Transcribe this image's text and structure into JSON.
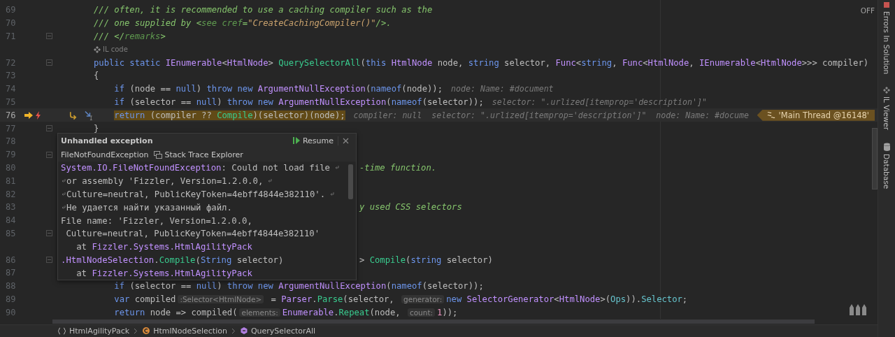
{
  "editor": {
    "inspection_toggle": "OFF",
    "rows": [
      {
        "kind": "line",
        "number": "69",
        "current": false,
        "tokens": [
          {
            "text": "/// often, it is recommended to use a caching compiler such as the",
            "kind": "comment"
          }
        ]
      },
      {
        "kind": "line",
        "number": "70",
        "current": false,
        "tokens": [
          {
            "text": "/// one supplied by <",
            "kind": "comment"
          },
          {
            "text": "see cref",
            "kind": "doc_tag"
          },
          {
            "text": "=",
            "kind": "comment"
          },
          {
            "text": "\"CreateCachingCompiler()\"",
            "kind": "doc_string"
          },
          {
            "text": "/>.",
            "kind": "comment"
          }
        ]
      },
      {
        "kind": "line",
        "number": "71",
        "current": false,
        "fold": true,
        "tokens": [
          {
            "text": "/// </",
            "kind": "comment"
          },
          {
            "text": "remarks",
            "kind": "doc_tag"
          },
          {
            "text": ">",
            "kind": "comment"
          }
        ]
      },
      {
        "kind": "lens",
        "label": "IL code"
      },
      {
        "kind": "line",
        "number": "72",
        "current": false,
        "fold": true,
        "tokens": [
          {
            "text": "public static ",
            "kind": "keyword"
          },
          {
            "text": "IEnumerable",
            "kind": "type"
          },
          {
            "text": "<",
            "kind": "plain"
          },
          {
            "text": "HtmlNode",
            "kind": "type"
          },
          {
            "text": "> ",
            "kind": "plain"
          },
          {
            "text": "QuerySelectorAll",
            "kind": "method"
          },
          {
            "text": "(",
            "kind": "plain"
          },
          {
            "text": "this ",
            "kind": "keyword"
          },
          {
            "text": "HtmlNode",
            "kind": "type"
          },
          {
            "text": " node, ",
            "kind": "plain"
          },
          {
            "text": "string",
            "kind": "keyword"
          },
          {
            "text": " selector, ",
            "kind": "plain"
          },
          {
            "text": "Func",
            "kind": "type"
          },
          {
            "text": "<",
            "kind": "plain"
          },
          {
            "text": "string",
            "kind": "keyword"
          },
          {
            "text": ", ",
            "kind": "plain"
          },
          {
            "text": "Func",
            "kind": "type"
          },
          {
            "text": "<",
            "kind": "plain"
          },
          {
            "text": "HtmlNode",
            "kind": "type"
          },
          {
            "text": ", ",
            "kind": "plain"
          },
          {
            "text": "IEnumerable",
            "kind": "type"
          },
          {
            "text": "<",
            "kind": "plain"
          },
          {
            "text": "HtmlNode",
            "kind": "type"
          },
          {
            "text": ">>> compiler)",
            "kind": "plain"
          }
        ]
      },
      {
        "kind": "line",
        "number": "73",
        "current": false,
        "tokens": [
          {
            "text": "{",
            "kind": "plain"
          }
        ]
      },
      {
        "kind": "line",
        "number": "74",
        "current": false,
        "tokens": [
          {
            "text": "    if",
            "kind": "keyword"
          },
          {
            "text": " (node == ",
            "kind": "plain"
          },
          {
            "text": "null",
            "kind": "keyword"
          },
          {
            "text": ") ",
            "kind": "plain"
          },
          {
            "text": "throw new ",
            "kind": "keyword"
          },
          {
            "text": "ArgumentNullException",
            "kind": "type"
          },
          {
            "text": "(",
            "kind": "plain"
          },
          {
            "text": "nameof",
            "kind": "keyword"
          },
          {
            "text": "(node));",
            "kind": "plain"
          },
          {
            "text": "node: Name: #document",
            "kind": "value"
          }
        ]
      },
      {
        "kind": "line",
        "number": "75",
        "current": false,
        "tokens": [
          {
            "text": "    if",
            "kind": "keyword"
          },
          {
            "text": " (selector == ",
            "kind": "plain"
          },
          {
            "text": "null",
            "kind": "keyword"
          },
          {
            "text": ") ",
            "kind": "plain"
          },
          {
            "text": "throw new ",
            "kind": "keyword"
          },
          {
            "text": "ArgumentNullException",
            "kind": "type"
          },
          {
            "text": "(",
            "kind": "plain"
          },
          {
            "text": "nameof",
            "kind": "keyword"
          },
          {
            "text": "(selector));",
            "kind": "plain"
          },
          {
            "text": "selector: \".urlized[itemprop='description']\"",
            "kind": "value"
          }
        ]
      },
      {
        "kind": "line",
        "number": "76",
        "current": true,
        "tokens": [
          {
            "text": "    return",
            "kind": "keyword"
          },
          {
            "text": " (compiler ?? ",
            "kind": "plain"
          },
          {
            "text": "Compile",
            "kind": "method"
          },
          {
            "text": ")(selector)(node);",
            "kind": "plain"
          },
          {
            "text": "compiler: null  selector: \".urlized[itemprop='description']\"  node: Name: #docume",
            "kind": "value"
          }
        ],
        "thread_badge": "'Main Thread @16148'"
      },
      {
        "kind": "line",
        "number": "77",
        "current": false,
        "fold": true,
        "tokens": [
          {
            "text": "}",
            "kind": "plain"
          }
        ]
      },
      {
        "kind": "line",
        "number": "78",
        "current": false,
        "tokens": []
      },
      {
        "kind": "line",
        "number": "79",
        "current": false,
        "fold": true,
        "tokens": []
      },
      {
        "kind": "line",
        "number": "80",
        "current": false,
        "covered": true,
        "tokens": [
          {
            "text": "-time function.",
            "kind": "comment"
          }
        ]
      },
      {
        "kind": "line",
        "number": "81",
        "current": false,
        "tokens": []
      },
      {
        "kind": "line",
        "number": "82",
        "current": false,
        "tokens": []
      },
      {
        "kind": "line",
        "number": "83",
        "current": false,
        "covered": true,
        "tokens": [
          {
            "text": "y used CSS selectors",
            "kind": "comment"
          }
        ]
      },
      {
        "kind": "line",
        "number": "84",
        "current": false,
        "tokens": []
      },
      {
        "kind": "line",
        "number": "85",
        "current": false,
        "fold": true,
        "tokens": []
      },
      {
        "kind": "spacer"
      },
      {
        "kind": "line",
        "number": "86",
        "current": false,
        "fold": true,
        "covered": true,
        "tokens": [
          {
            "text": "> ",
            "kind": "plain"
          },
          {
            "text": "Compile",
            "kind": "method"
          },
          {
            "text": "(",
            "kind": "plain"
          },
          {
            "text": "string",
            "kind": "keyword"
          },
          {
            "text": " selector)",
            "kind": "plain"
          }
        ]
      },
      {
        "kind": "line",
        "number": "87",
        "current": false,
        "tokens": []
      },
      {
        "kind": "line",
        "number": "88",
        "current": false,
        "tokens": [
          {
            "text": "    if",
            "kind": "keyword"
          },
          {
            "text": " (selector == ",
            "kind": "plain"
          },
          {
            "text": "null",
            "kind": "keyword"
          },
          {
            "text": ") ",
            "kind": "plain"
          },
          {
            "text": "throw new ",
            "kind": "keyword"
          },
          {
            "text": "ArgumentNullException",
            "kind": "type"
          },
          {
            "text": "(",
            "kind": "plain"
          },
          {
            "text": "nameof",
            "kind": "keyword"
          },
          {
            "text": "(selector));",
            "kind": "plain"
          }
        ]
      },
      {
        "kind": "line",
        "number": "89",
        "current": false,
        "tokens": [
          {
            "text": "    var",
            "kind": "keyword"
          },
          {
            "text": " compiled",
            "kind": "plain"
          },
          {
            "text": ":Selector<HtmlNode>",
            "kind": "inlay"
          },
          {
            "text": " = ",
            "kind": "plain"
          },
          {
            "text": "Parser",
            "kind": "type"
          },
          {
            "text": ".",
            "kind": "plain"
          },
          {
            "text": "Parse",
            "kind": "method"
          },
          {
            "text": "(selector, ",
            "kind": "plain"
          },
          {
            "text": "generator:",
            "kind": "inlay"
          },
          {
            "text": "new ",
            "kind": "keyword"
          },
          {
            "text": "SelectorGenerator",
            "kind": "type"
          },
          {
            "text": "<",
            "kind": "plain"
          },
          {
            "text": "HtmlNode",
            "kind": "type"
          },
          {
            "text": ">(",
            "kind": "plain"
          },
          {
            "text": "Ops",
            "kind": "field"
          },
          {
            "text": ")).",
            "kind": "plain"
          },
          {
            "text": "Selector",
            "kind": "field"
          },
          {
            "text": ";",
            "kind": "plain"
          }
        ]
      },
      {
        "kind": "line",
        "number": "90",
        "current": false,
        "tokens": [
          {
            "text": "    return",
            "kind": "keyword"
          },
          {
            "text": " node => compiled(",
            "kind": "plain"
          },
          {
            "text": "elements:",
            "kind": "inlay"
          },
          {
            "text": "Enumerable",
            "kind": "type"
          },
          {
            "text": ".",
            "kind": "plain"
          },
          {
            "text": "Repeat",
            "kind": "method"
          },
          {
            "text": "(node, ",
            "kind": "plain"
          },
          {
            "text": "count:",
            "kind": "inlay"
          },
          {
            "text": "1",
            "kind": "number"
          },
          {
            "text": "));",
            "kind": "plain"
          }
        ]
      }
    ]
  },
  "exception_popup": {
    "title": "Unhandled exception",
    "resume": "Resume",
    "exception_type": "FileNotFoundException",
    "stack_trace_link": "Stack Trace Explorer",
    "message_lines": [
      {
        "wrap_start": false,
        "wrap_end": true,
        "tokens": [
          {
            "text": "System.IO.FileNotFoundException",
            "kind": "type"
          },
          {
            "text": ": Could not load file",
            "kind": "plain"
          }
        ]
      },
      {
        "wrap_start": true,
        "wrap_end": true,
        "tokens": [
          {
            "text": "or assembly 'Fizzler, Version=1.2.0.0,",
            "kind": "plain"
          }
        ]
      },
      {
        "wrap_start": true,
        "wrap_end": true,
        "tokens": [
          {
            "text": "Culture=neutral, PublicKeyToken=4ebff4844e382110'.",
            "kind": "plain"
          }
        ]
      },
      {
        "wrap_start": true,
        "wrap_end": false,
        "tokens": [
          {
            "text": "Не удается найти указанный файл.",
            "kind": "plain"
          }
        ]
      },
      {
        "wrap_start": false,
        "wrap_end": false,
        "tokens": [
          {
            "text": "File name: 'Fizzler, Version=1.2.0.0,",
            "kind": "plain"
          }
        ]
      },
      {
        "wrap_start": false,
        "wrap_end": false,
        "tokens": [
          {
            "text": " Culture=neutral, PublicKeyToken=4ebff4844e382110'",
            "kind": "plain"
          }
        ]
      },
      {
        "wrap_start": false,
        "wrap_end": false,
        "tokens": [
          {
            "text": "   at ",
            "kind": "plain"
          },
          {
            "text": "Fizzler.Systems.HtmlAgilityPack",
            "kind": "type"
          }
        ]
      },
      {
        "wrap_start": false,
        "wrap_end": false,
        "tokens": [
          {
            "text": ".HtmlNodeSelection",
            "kind": "type"
          },
          {
            "text": ".",
            "kind": "plain"
          },
          {
            "text": "Compile",
            "kind": "method"
          },
          {
            "text": "(",
            "kind": "plain"
          },
          {
            "text": "String",
            "kind": "keyword"
          },
          {
            "text": " selector)",
            "kind": "plain"
          }
        ]
      },
      {
        "wrap_start": false,
        "wrap_end": false,
        "tokens": [
          {
            "text": "   at ",
            "kind": "plain"
          },
          {
            "text": "Fizzler.Systems.HtmlAgilityPack",
            "kind": "type"
          }
        ]
      }
    ]
  },
  "breadcrumbs": [
    {
      "kind": "namespace",
      "label": "HtmlAgilityPack"
    },
    {
      "kind": "class",
      "label": "HtmlNodeSelection"
    },
    {
      "kind": "method",
      "label": "QuerySelectorAll"
    }
  ],
  "tool_windows": [
    {
      "kind": "errors",
      "label": "Errors In Solution"
    },
    {
      "kind": "il",
      "label": "IL Viewer"
    },
    {
      "kind": "database",
      "label": "Database"
    }
  ]
}
